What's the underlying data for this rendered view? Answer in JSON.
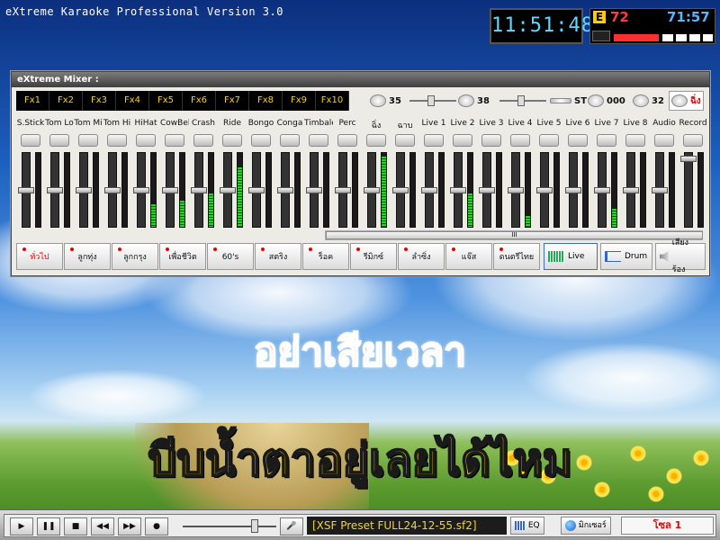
{
  "app": {
    "title": "eXtreme Karaoke Professional Version 3.0"
  },
  "clock": {
    "time": "11:51:48"
  },
  "score": {
    "badge": "E",
    "score1": "72",
    "score2": "71:57"
  },
  "mixer": {
    "title": "eXtreme Mixer :",
    "fx": [
      "Fx1",
      "Fx2",
      "Fx3",
      "Fx4",
      "Fx5",
      "Fx6",
      "Fx7",
      "Fx8",
      "Fx9",
      "Fx10"
    ],
    "controls": {
      "v1": "35",
      "v2": "38",
      "st": "ST",
      "v3": "000",
      "v4": "32",
      "last": "ฉิ่ง"
    },
    "channels": [
      {
        "label": "S.Stick",
        "icon": "drumstick-icon",
        "fader": 0.5,
        "meter": 0
      },
      {
        "label": "Tom Lo",
        "icon": "tom-drum-icon",
        "fader": 0.5,
        "meter": 0
      },
      {
        "label": "Tom Mi",
        "icon": "tom-drum-icon",
        "fader": 0.5,
        "meter": 0
      },
      {
        "label": "Tom Hi",
        "icon": "tom-drum-icon",
        "fader": 0.5,
        "meter": 0
      },
      {
        "label": "HiHat",
        "icon": "hihat-icon",
        "fader": 0.5,
        "meter": 0.3
      },
      {
        "label": "CowBell",
        "icon": "cowbell-icon",
        "fader": 0.5,
        "meter": 0.35
      },
      {
        "label": "Crash",
        "icon": "cymbal-icon",
        "fader": 0.5,
        "meter": 0.45
      },
      {
        "label": "Ride",
        "icon": "cymbal-icon",
        "fader": 0.5,
        "meter": 0.8
      },
      {
        "label": "Bongo",
        "icon": "bongo-icon",
        "fader": 0.5,
        "meter": 0
      },
      {
        "label": "Conga",
        "icon": "conga-icon",
        "fader": 0.5,
        "meter": 0
      },
      {
        "label": "Timbale",
        "icon": "timbale-icon",
        "fader": 0.5,
        "meter": 0
      },
      {
        "label": "Perc",
        "icon": "maracas-icon",
        "fader": 0.5,
        "meter": 0
      },
      {
        "label": "ฉิ่ง",
        "icon": "ching-icon",
        "fader": 0.5,
        "meter": 0.95
      },
      {
        "label": "ฉาบ",
        "icon": "chab-icon",
        "fader": 0.5,
        "meter": 0
      },
      {
        "label": "Live 1",
        "icon": "waveform-icon",
        "fader": 0.5,
        "meter": 0
      },
      {
        "label": "Live 2",
        "icon": "guitar-icon",
        "fader": 0.5,
        "meter": 0.45
      },
      {
        "label": "Live 3",
        "icon": "guitar-icon",
        "fader": 0.5,
        "meter": 0
      },
      {
        "label": "Live 4",
        "icon": "guitar-icon",
        "fader": 0.5,
        "meter": 0.15
      },
      {
        "label": "Live 5",
        "icon": "keyboard-icon",
        "fader": 0.5,
        "meter": 0
      },
      {
        "label": "Live 6",
        "icon": "bass-icon",
        "fader": 0.5,
        "meter": 0
      },
      {
        "label": "Live 7",
        "icon": "bass-icon",
        "fader": 0.5,
        "meter": 0.25
      },
      {
        "label": "Live 8",
        "icon": "microphone-icon",
        "fader": 0.5,
        "meter": 0
      },
      {
        "label": "Audio",
        "icon": "cd-icon",
        "fader": 0.5,
        "meter": 0
      },
      {
        "label": "Record",
        "icon": "record-icon",
        "fader": 0.05,
        "meter": 0
      }
    ],
    "presets": [
      "ทั่วไป",
      "ลูกทุ่ง",
      "ลูกกรุง",
      "เพื่อชีวิต",
      "60's",
      "สตริง",
      "ร็อค",
      "รีมิกซ์",
      "ลำซิ่ง",
      "แจ๊ส",
      "ดนตรีไทย"
    ],
    "modes": {
      "live": "Live",
      "drum": "Drum",
      "voice": "เสียงร้อง"
    }
  },
  "lyrics": {
    "line1": "อย่าเสียเวลา",
    "line2": "บีบน้ำตาอยู่เลยได้ไหม"
  },
  "bottom": {
    "transport": [
      "▶",
      "❚❚",
      "■",
      "◀◀",
      "▶▶",
      "●"
    ],
    "file": "[XSF Preset FULL24-12-55.sf2]",
    "eq": "EQ",
    "mixer": "มิกเซอร์",
    "voice": "โซล 1"
  }
}
